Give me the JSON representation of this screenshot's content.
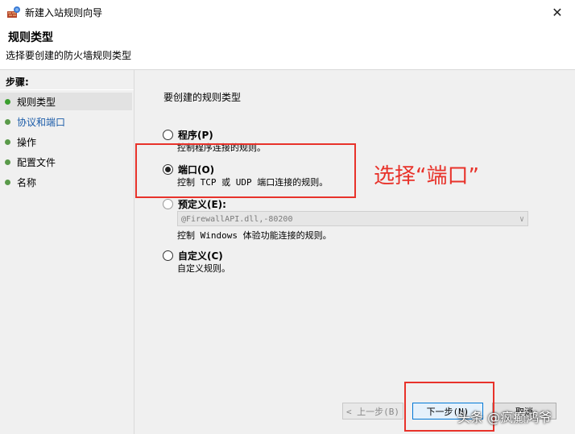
{
  "window": {
    "title": "新建入站规则向导",
    "close_symbol": "✕"
  },
  "header": {
    "title": "规则类型",
    "subtitle": "选择要创建的防火墙规则类型"
  },
  "steps": {
    "label": "步骤:",
    "items": [
      {
        "label": "规则类型",
        "state": "current"
      },
      {
        "label": "协议和端口",
        "state": "link"
      },
      {
        "label": "操作",
        "state": "normal"
      },
      {
        "label": "配置文件",
        "state": "normal"
      },
      {
        "label": "名称",
        "state": "normal"
      }
    ]
  },
  "main": {
    "prompt": "要创建的规则类型",
    "options": [
      {
        "label": "程序(P)",
        "desc": "控制程序连接的规则。",
        "checked": false
      },
      {
        "label": "端口(O)",
        "desc": "控制 TCP 或 UDP 端口连接的规则。",
        "checked": true
      },
      {
        "label": "预定义(E):",
        "desc": "控制 Windows 体验功能连接的规则。",
        "checked": false
      },
      {
        "label": "自定义(C)",
        "desc": "自定义规则。",
        "checked": false
      }
    ],
    "predefined_value": "@FirewallAPI.dll,-80200"
  },
  "buttons": {
    "back": "< 上一步(B)",
    "next": "下一步(N)",
    "cancel": "取消"
  },
  "annotation": {
    "text": "选择“端口”",
    "color": "#e8322a"
  },
  "watermark": "头条 @疯癫鸿爷"
}
